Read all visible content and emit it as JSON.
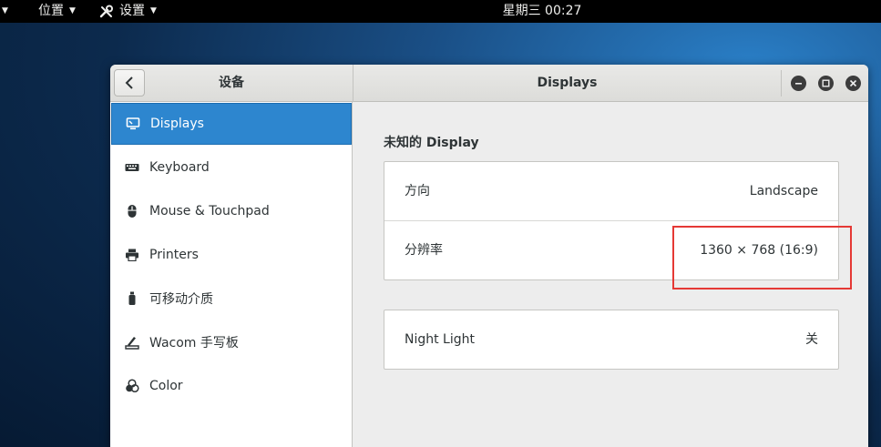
{
  "topbar": {
    "places_label": "位置",
    "settings_label": "设置",
    "clock": "星期三 00:27"
  },
  "window": {
    "left_title": "设备",
    "right_title": "Displays"
  },
  "sidebar": {
    "items": [
      {
        "label": "Displays",
        "icon": "display-icon",
        "active": true
      },
      {
        "label": "Keyboard",
        "icon": "keyboard-icon"
      },
      {
        "label": "Mouse & Touchpad",
        "icon": "mouse-icon"
      },
      {
        "label": "Printers",
        "icon": "printer-icon"
      },
      {
        "label": "可移动介质",
        "icon": "usb-drive-icon"
      },
      {
        "label": "Wacom 手写板",
        "icon": "tablet-icon"
      },
      {
        "label": "Color",
        "icon": "color-icon"
      }
    ]
  },
  "display": {
    "section_title": "未知的 Display",
    "orientation_label": "方向",
    "orientation_value": "Landscape",
    "resolution_label": "分辨率",
    "resolution_value": "1360 × 768 (16:9)",
    "night_light_label": "Night Light",
    "night_light_value": "关"
  },
  "colors": {
    "accent": "#2d86cf",
    "highlight_box": "#e53935"
  }
}
